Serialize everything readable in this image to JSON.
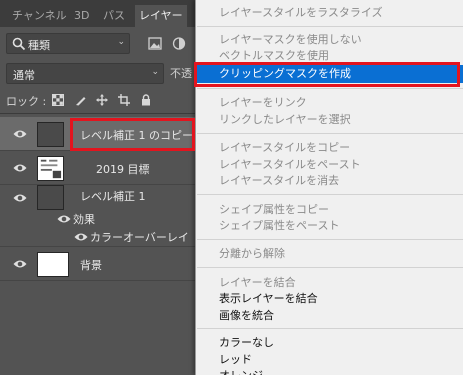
{
  "panel": {
    "tabs": [
      {
        "label": "チャンネル"
      },
      {
        "label": "3D"
      },
      {
        "label": "パス"
      },
      {
        "label": "レイヤー"
      }
    ],
    "filter": {
      "kind_label": "種類"
    },
    "blend_mode": "通常",
    "opacity_label": "不透",
    "lock_label": "ロック :",
    "layers": [
      {
        "name": "レベル補正 1 のコピー",
        "selected": true
      },
      {
        "name": "2019 目標"
      },
      {
        "name": "レベル補正 1"
      },
      {
        "name": "効果"
      },
      {
        "name": "カラーオーバーレイ"
      },
      {
        "name": "背景"
      }
    ]
  },
  "menu": {
    "items": [
      {
        "label": "レイヤースタイルをラスタライズ",
        "state": "disabled"
      },
      {
        "label": "レイヤーマスクを使用しない",
        "state": "disabled"
      },
      {
        "label": "ベクトルマスクを使用",
        "state": "disabled"
      },
      {
        "label": "クリッピングマスクを作成",
        "state": "hover"
      },
      {
        "label": "レイヤーをリンク",
        "state": "disabled"
      },
      {
        "label": "リンクしたレイヤーを選択",
        "state": "disabled"
      },
      {
        "label": "レイヤースタイルをコピー",
        "state": "disabled"
      },
      {
        "label": "レイヤースタイルをペースト",
        "state": "disabled"
      },
      {
        "label": "レイヤースタイルを消去",
        "state": "disabled"
      },
      {
        "label": "シェイプ属性をコピー",
        "state": "disabled"
      },
      {
        "label": "シェイプ属性をペースト",
        "state": "disabled"
      },
      {
        "label": "分離から解除",
        "state": "disabled"
      },
      {
        "label": "レイヤーを結合",
        "state": "disabled"
      },
      {
        "label": "表示レイヤーを結合",
        "state": "enabled"
      },
      {
        "label": "画像を統合",
        "state": "enabled"
      },
      {
        "label": "カラーなし",
        "state": "enabled"
      },
      {
        "label": "レッド",
        "state": "enabled"
      },
      {
        "label": "オレンジ",
        "state": "enabled"
      }
    ]
  },
  "colors": {
    "highlight_box": "#e3141e",
    "menu_hover": "#0a6fd3",
    "panel_bg": "#535353"
  }
}
